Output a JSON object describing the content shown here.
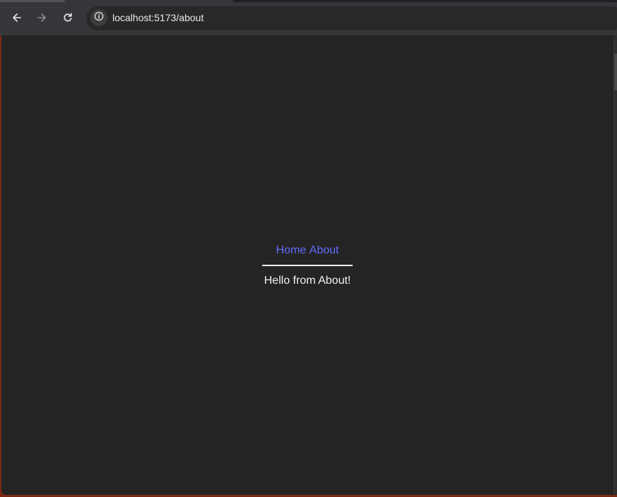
{
  "browser": {
    "url": "localhost:5173/about",
    "icons": {
      "back": "arrow-left-icon",
      "forward": "arrow-right-icon",
      "reload": "reload-icon",
      "site_info": "info-icon"
    }
  },
  "page": {
    "nav": {
      "home_label": "Home",
      "about_label": "About"
    },
    "message": "Hello from About!"
  },
  "colors": {
    "link": "#646cff",
    "page_background": "#242424",
    "text": "#f2f2f2",
    "toolbar": "#35363a"
  }
}
